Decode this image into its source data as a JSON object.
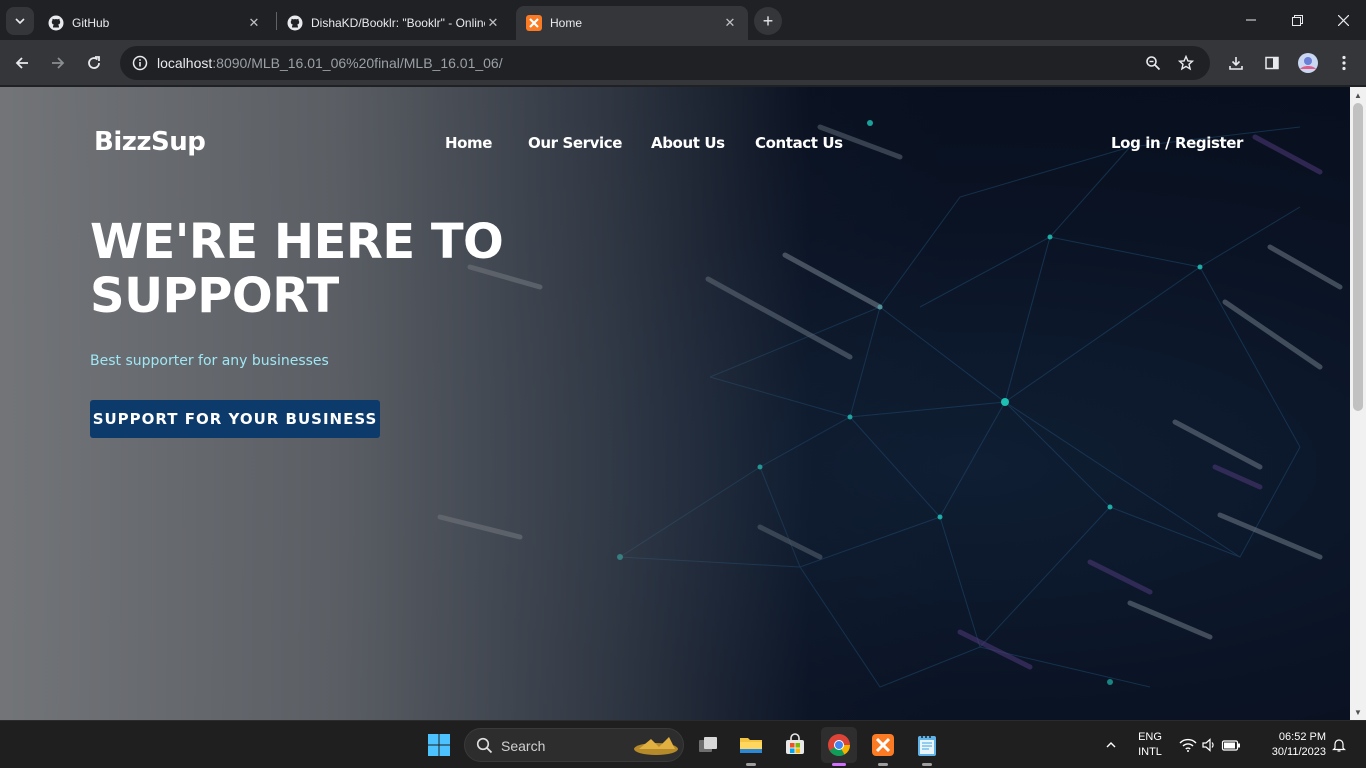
{
  "browser": {
    "tabs": [
      {
        "title": "GitHub",
        "icon": "github-icon"
      },
      {
        "title": "DishaKD/Booklr: \"Booklr\" - Online",
        "icon": "github-icon"
      },
      {
        "title": "Home",
        "icon": "xampp-icon",
        "active": true
      }
    ],
    "url_host": "localhost",
    "url_path": ":8090/MLB_16.01_06%20final/MLB_16.01_06/"
  },
  "site": {
    "brand": "BizzSup",
    "nav": [
      "Home",
      "Our Service",
      "About Us",
      "Contact Us"
    ],
    "login": "Log in / Register",
    "headline_line1": "WE'RE HERE TO",
    "headline_line2": "SUPPORT",
    "tagline": "Best supporter for any businesses",
    "cta": "SUPPORT FOR YOUR BUSINESS",
    "accent_color": "#0b3a6b",
    "tagline_color": "#9fe7f5"
  },
  "taskbar": {
    "search_label": "Search",
    "lang_line1": "ENG",
    "lang_line2": "INTL",
    "time": "06:52 PM",
    "date": "30/11/2023"
  }
}
